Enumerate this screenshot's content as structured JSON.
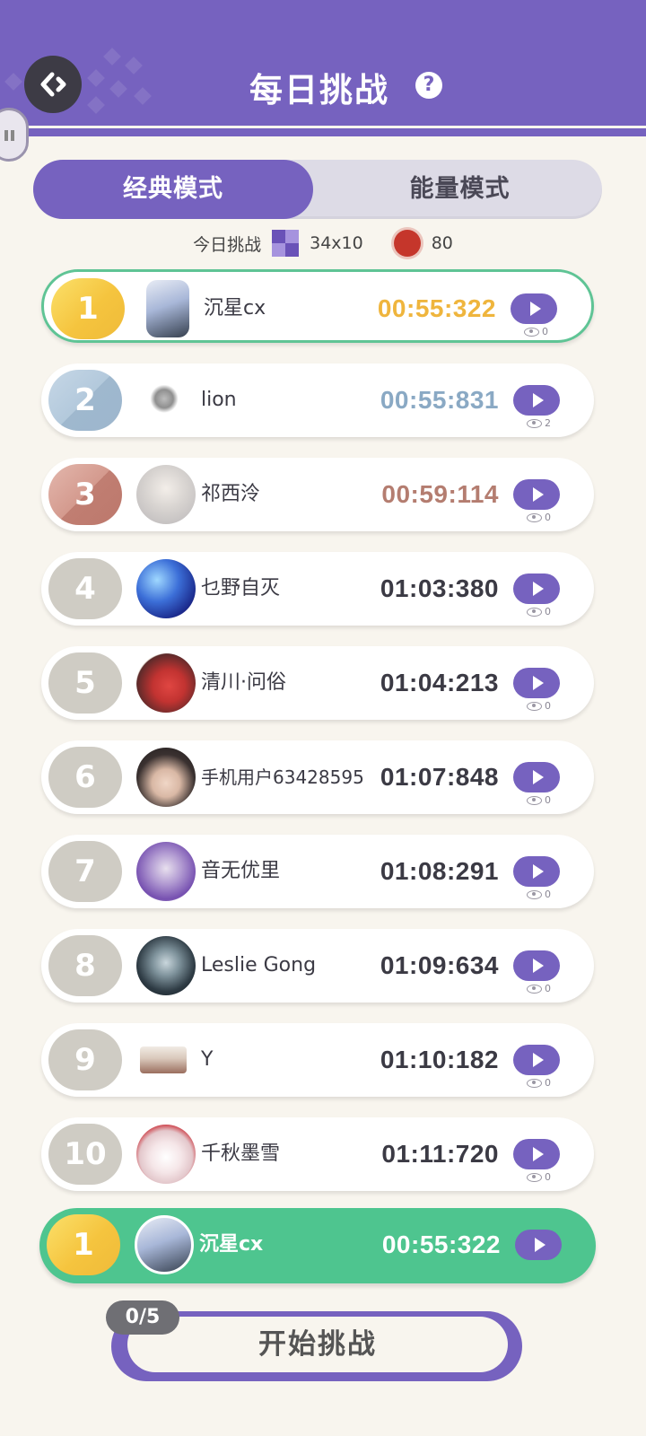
{
  "header": {
    "title": "每日挑战",
    "help_icon": "?"
  },
  "tabs": [
    {
      "label": "经典模式",
      "active": true
    },
    {
      "label": "能量模式",
      "active": false
    }
  ],
  "challenge_info": {
    "label": "今日挑战",
    "size": "34x10",
    "mines": "80"
  },
  "leaderboard": [
    {
      "rank": "1",
      "name": "沉星cx",
      "time": "00:55:322",
      "views": "0"
    },
    {
      "rank": "2",
      "name": "lion",
      "time": "00:55:831",
      "views": "2"
    },
    {
      "rank": "3",
      "name": "祁西泠",
      "time": "00:59:114",
      "views": "0"
    },
    {
      "rank": "4",
      "name": "乜野自灭",
      "time": "01:03:380",
      "views": "0"
    },
    {
      "rank": "5",
      "name": "清川·问俗",
      "time": "01:04:213",
      "views": "0"
    },
    {
      "rank": "6",
      "name": "手机用户63428595",
      "time": "01:07:848",
      "views": "0"
    },
    {
      "rank": "7",
      "name": "音无优里",
      "time": "01:08:291",
      "views": "0"
    },
    {
      "rank": "8",
      "name": "Leslie Gong",
      "time": "01:09:634",
      "views": "0"
    },
    {
      "rank": "9",
      "name": "Y",
      "time": "01:10:182",
      "views": "0"
    },
    {
      "rank": "10",
      "name": "千秋墨雪",
      "time": "01:11:720",
      "views": "0"
    }
  ],
  "my_record": {
    "rank": "1",
    "name": "沉星cx",
    "time": "00:55:322"
  },
  "start": {
    "label": "开始挑战",
    "attempts": "0/5"
  },
  "colors": {
    "accent": "#7662bf",
    "highlight": "#4ec58f",
    "gold": "#efb53d",
    "silver": "#8aa9c4",
    "bronze": "#b47d70"
  }
}
